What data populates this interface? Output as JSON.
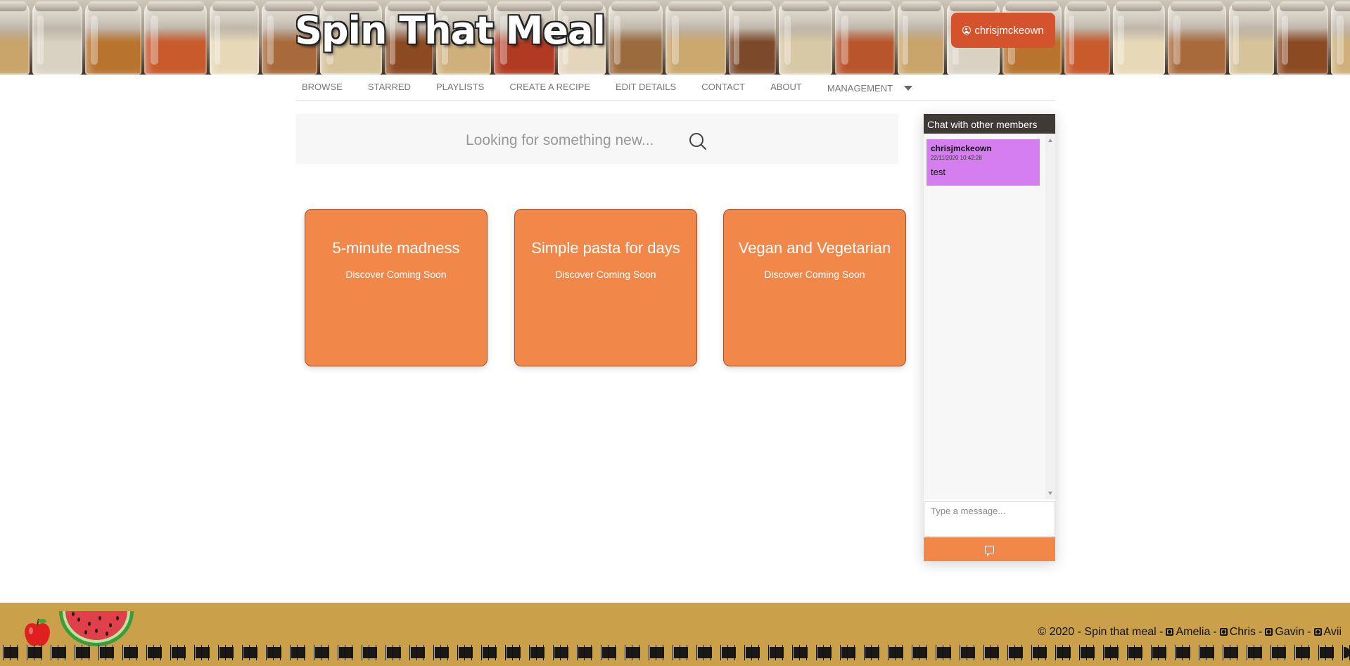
{
  "header": {
    "site_title": "Spin That Meal",
    "user_button_label": "chrisjmckeown"
  },
  "nav": {
    "items": [
      {
        "label": "BROWSE"
      },
      {
        "label": "STARRED"
      },
      {
        "label": "PLAYLISTS"
      },
      {
        "label": "CREATE A RECIPE"
      },
      {
        "label": "EDIT DETAILS"
      },
      {
        "label": "CONTACT"
      },
      {
        "label": "ABOUT"
      },
      {
        "label": "MANAGEMENT"
      }
    ]
  },
  "search": {
    "placeholder": "Looking for something new..."
  },
  "cards": [
    {
      "title": "5-minute madness",
      "subtitle": "Discover Coming Soon"
    },
    {
      "title": "Simple pasta for days",
      "subtitle": "Discover Coming Soon"
    },
    {
      "title": "Vegan and Vegetarian",
      "subtitle": "Discover Coming Soon"
    }
  ],
  "chat": {
    "header": "Chat with other members",
    "messages": [
      {
        "user": "chrisjmckeown",
        "timestamp": "22/11/2020 10:42:28",
        "text": "test"
      }
    ],
    "input_placeholder": "Type a message..."
  },
  "footer": {
    "copyright": "© 2020 - Spin that meal -",
    "sep": "-",
    "links": [
      "Amelia",
      "Chris",
      "Gavin",
      "Avii"
    ]
  },
  "colors": {
    "accent_orange": "#f2874a",
    "user_button": "#d4532c",
    "chat_header": "#3f3b34",
    "message_bubble": "#d57eef",
    "footer_bg": "#caa04a"
  }
}
